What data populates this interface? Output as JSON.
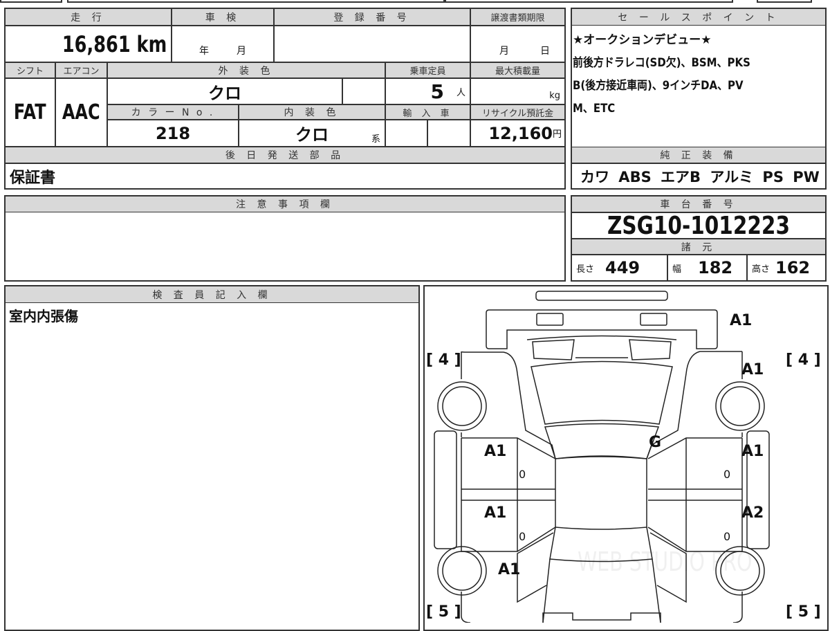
{
  "vehicle": {
    "mileage_label": "走 行",
    "mileage_value": "16,861 km",
    "inspection_label": "車 検",
    "inspection_year_unit": "年",
    "inspection_month_unit": "月",
    "registration_label": "登 録 番 号",
    "transfer_deadline_label": "譲渡書類期限",
    "transfer_month_unit": "月",
    "transfer_day_unit": "日",
    "shift_label": "シフト",
    "shift_value": "FAT",
    "ac_label": "エアコン",
    "ac_value": "AAC",
    "exterior_color_label": "外 装 色",
    "exterior_color_value": "クロ",
    "capacity_label": "乗車定員",
    "capacity_value": "5",
    "capacity_unit": "人",
    "max_load_label": "最大積載量",
    "max_load_unit": "kg",
    "color_no_label": "カ ラ ー N o .",
    "color_no_value": "218",
    "interior_color_label": "内 装 色",
    "interior_color_value": "クロ",
    "interior_color_suffix": "系",
    "import_label": "輸 入 車",
    "recycle_label": "リサイクル預託金",
    "recycle_value": "12,160",
    "recycle_unit": "円",
    "later_parts_label": "後 日 発 送 部 品",
    "later_parts_value": "保証書"
  },
  "sales_points": {
    "label": "セ ー ル ス ポ イ ン ト",
    "lines": [
      "★オークションデビュー★",
      "前後方ドラレコ(SD欠)、BSM、PKS",
      "B(後方接近車両)、9インチDA、PV",
      "M、ETC"
    ]
  },
  "equipment": {
    "label": "純 正 装 備",
    "value": "カワ ABS エアB アルミ PS PW"
  },
  "notes": {
    "label": "注 意 事 項 欄",
    "value": ""
  },
  "chassis": {
    "label": "車 台 番 号",
    "value": "ZSG10-1012223",
    "specs_label": "諸 元",
    "length_label": "長さ",
    "length_value": "449",
    "width_label": "幅",
    "width_value": "182",
    "height_label": "高さ",
    "height_value": "162"
  },
  "inspector": {
    "label": "検 査 員 記 入 欄",
    "value": "室内内張傷"
  },
  "diagram": {
    "front_left_tire": "[ 4 ]",
    "front_right_tire": "[ 4 ]",
    "rear_left_tire": "[ 5 ]",
    "rear_right_tire": "[ 5 ]",
    "bumper_mark": "A1",
    "front_right_fender_mark": "A1",
    "windshield_mark": "G",
    "front_left_door_mark": "A1",
    "front_left_door_zero": "0",
    "front_right_door_mark": "A1",
    "front_right_door_zero": "0",
    "rear_left_door_mark": "A1",
    "rear_left_door_zero": "0",
    "rear_right_door_mark": "A2",
    "rear_right_door_zero": "0",
    "rear_left_quarter_mark": "A1",
    "watermark": "WEB STUDIO PRO"
  }
}
